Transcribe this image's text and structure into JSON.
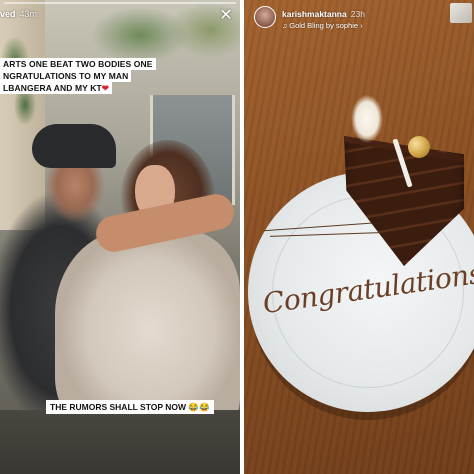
{
  "left_story": {
    "username_fragment": "ved",
    "time": "43m",
    "close_label": "✕",
    "caption_lines": [
      "ARTS ONE BEAT TWO BODIES ONE",
      "NGRATULATIONS TO MY MAN",
      "LBANGERA AND MY KT"
    ],
    "heart": "❤",
    "rumor_text": "THE RUMORS SHALL STOP NOW",
    "rumor_emoji": "😂😂"
  },
  "right_story": {
    "username": "karishmaktanna",
    "time": "23h",
    "music_icon": "♫",
    "music_text": "Gold Bling by sophie",
    "music_chevron": "›",
    "plate_text": "Congratulations"
  },
  "icons": {
    "close": "close-icon",
    "music": "music-note-icon",
    "heart": "heart-icon"
  },
  "colors": {
    "heart": "#e0232e",
    "table_wood": "#8a4f22",
    "chocolate": "#3b1d10"
  }
}
